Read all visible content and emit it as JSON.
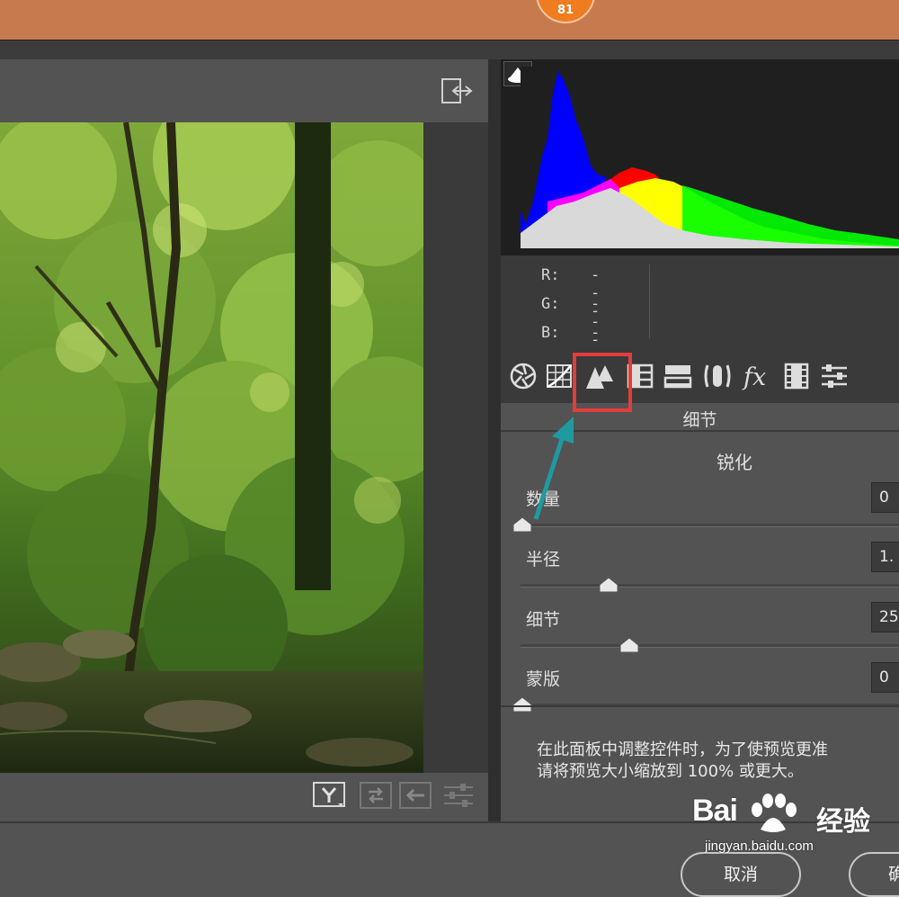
{
  "header": {
    "badge": "81"
  },
  "left_toolbar": {
    "icons": [
      "toggle-view-icon",
      "before-after-y-icon",
      "swap-icon",
      "copy-icon",
      "settings-sliders-icon"
    ]
  },
  "histogram": {
    "readout": [
      {
        "label": "R:",
        "value": "---"
      },
      {
        "label": "G:",
        "value": "---"
      },
      {
        "label": "B:",
        "value": "---"
      }
    ],
    "channel_colors": {
      "blue": "#0000ff",
      "red": "#ff0000",
      "magenta": "#ff00ff",
      "yellow": "#ffff00",
      "green": "#00ff00",
      "neutral": "#d9d9d9"
    }
  },
  "tools": [
    "aperture-icon",
    "tone-curve-icon",
    "detail-icon",
    "hsl-icon",
    "split-toning-icon",
    "lens-icon",
    "fx-icon",
    "camera-calibration-icon",
    "presets-icon"
  ],
  "panel": {
    "title": "细节",
    "section": "锐化",
    "sliders": [
      {
        "label": "数量",
        "value": "0",
        "position": 0.0
      },
      {
        "label": "半径",
        "value": "1.",
        "position": 0.23
      },
      {
        "label": "细节",
        "value": "25",
        "position": 0.28
      },
      {
        "label": "蒙版",
        "value": "0",
        "position": 0.0
      }
    ],
    "note_line1": "在此面板中调整控件时，为了使预览更准",
    "note_line2": "请将预览大小缩放到 100% 或更大。"
  },
  "footer": {
    "cancel_label": "取消",
    "ok_label": "确"
  },
  "watermark": {
    "brand": "Bai",
    "brand_suffix": "经验",
    "url": "jingyan.baidu.com"
  },
  "colors": {
    "accent_highlight": "#e23d3d",
    "arrow": "#1f9aa0"
  }
}
